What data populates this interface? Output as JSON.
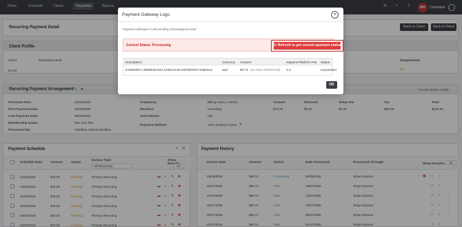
{
  "nav": {
    "home": "Home",
    "schedule": "Schedule",
    "clients": "Clients",
    "payments": "Payments",
    "reports": "Reports",
    "user": "Columbus",
    "avatar_initials": "MH"
  },
  "page": {
    "title": "Recurring Payment Detail",
    "back_to_client": "Back to Client",
    "back_to_retail": "Back to Retail"
  },
  "client_profile": {
    "title": "Client Profile",
    "client_label": "Client:",
    "client_name": "Ravindra Kumar",
    "email_label": "Email:",
    "suspensions_label": "Suspensions"
  },
  "arrangement": {
    "title": "Recurring Payment Arrangement",
    "current_status_label": "Current Status:",
    "current_status": "Active",
    "fields": [
      {
        "label": "Purchase Date:",
        "value": "20/05/2026"
      },
      {
        "label": "First Payment Date:",
        "value": "20/05/2026"
      },
      {
        "label": "Last Payment Date:",
        "value": "05/08/2026"
      },
      {
        "label": "Membership Name:",
        "value": "Two and Two"
      },
      {
        "label": "Processed By:",
        "value": "Sandbox Hybrid Sandbox"
      }
    ],
    "frequency_label": "Frequency:",
    "frequency_value": "Billing every 1 weeks",
    "duration_label": "Duration:",
    "duration_value": "Unending",
    "auto_renew_label": "Auto-Renew:",
    "auto_renew_value": "ON",
    "payment_method_label": "Payment Method:",
    "payment_method_value": "VISA ending in 4242",
    "amount_headers": [
      "Amount",
      "Discount",
      "Setup Fee",
      "Tax",
      "Total"
    ],
    "amount_values": [
      "$78.00",
      "$0.00",
      "$0.00",
      "$80.08",
      "$156.00"
    ]
  },
  "payment_schedule": {
    "title": "Payment Schedule",
    "headers": [
      "Schedule Date",
      "Amount",
      "Status",
      "Invoice Type"
    ],
    "filter_value": "All Recurring",
    "show_results_label": "Show Results:",
    "show_results_value": "10",
    "rows": [
      {
        "date": "12/08/2026",
        "amount": "$78.00",
        "status": "Pending",
        "type": "Primary Recurring"
      },
      {
        "date": "19/08/2026",
        "amount": "$78.00",
        "status": "Pending",
        "type": "Primary Recurring"
      },
      {
        "date": "26/08/2026",
        "amount": "$78.00",
        "status": "Pending",
        "type": "Primary Recurring"
      },
      {
        "date": "02/09/2026",
        "amount": "$78.00",
        "status": "Pending",
        "type": "Primary Recurring"
      },
      {
        "date": "09/09/2026",
        "amount": "$78.00",
        "status": "Pending",
        "type": "Primary Recurring"
      },
      {
        "date": "16/09/2026",
        "amount": "$78.00",
        "status": "Pending",
        "type": "Primary Recurring"
      }
    ]
  },
  "payment_history": {
    "title": "Payment History",
    "headers": [
      "Invoice Date",
      "Amount",
      "Status",
      "Date Processed",
      "Processed Through"
    ],
    "show_results_label": "Show Results:",
    "show_results_value": "10",
    "rows": [
      {
        "date": "05/08/2026",
        "amount": "$80.74",
        "status": "Processing",
        "processed": "05/08/2026",
        "through": "Stripe Express"
      },
      {
        "date": "29/07/2026",
        "amount": "$80.74",
        "status": "Paid",
        "processed": "29/07/2026",
        "through": "Stripe Express"
      },
      {
        "date": "22/07/2026",
        "amount": "$80.74",
        "status": "Paid",
        "processed": "22/07/2026",
        "through": "Stripe Express"
      },
      {
        "date": "15/07/2026",
        "amount": "$80.74",
        "status": "Paid",
        "processed": "15/07/2026",
        "through": "Stripe Express"
      },
      {
        "date": "08/07/2026",
        "amount": "$80.74",
        "status": "Paid",
        "processed": "08/07/2026",
        "through": "Stripe Express"
      },
      {
        "date": "01/07/2026",
        "amount": "$80.74",
        "status": "Paid",
        "processed": "01/07/2026",
        "through": "Stripe Express"
      }
    ]
  },
  "modal": {
    "title": "Payment Gateway Logs",
    "subtitle": "Payment attempts in descending chronological order.",
    "current_status": "Current Status: Processing",
    "refresh_button": "Refresh to get current payment status",
    "headers": [
      "Description",
      "Currency",
      "Amount",
      "Hapana Platform Fee",
      "Status"
    ],
    "row": {
      "description": "8-609339-C-6059949-INV-133613146-CRONPINV-makeinvo",
      "currency": "aud",
      "amount": "80.74",
      "amount_note": "(on date 05/08/2026)",
      "fee": "3.3",
      "status": "succeeded"
    },
    "ok_label": "OK"
  }
}
